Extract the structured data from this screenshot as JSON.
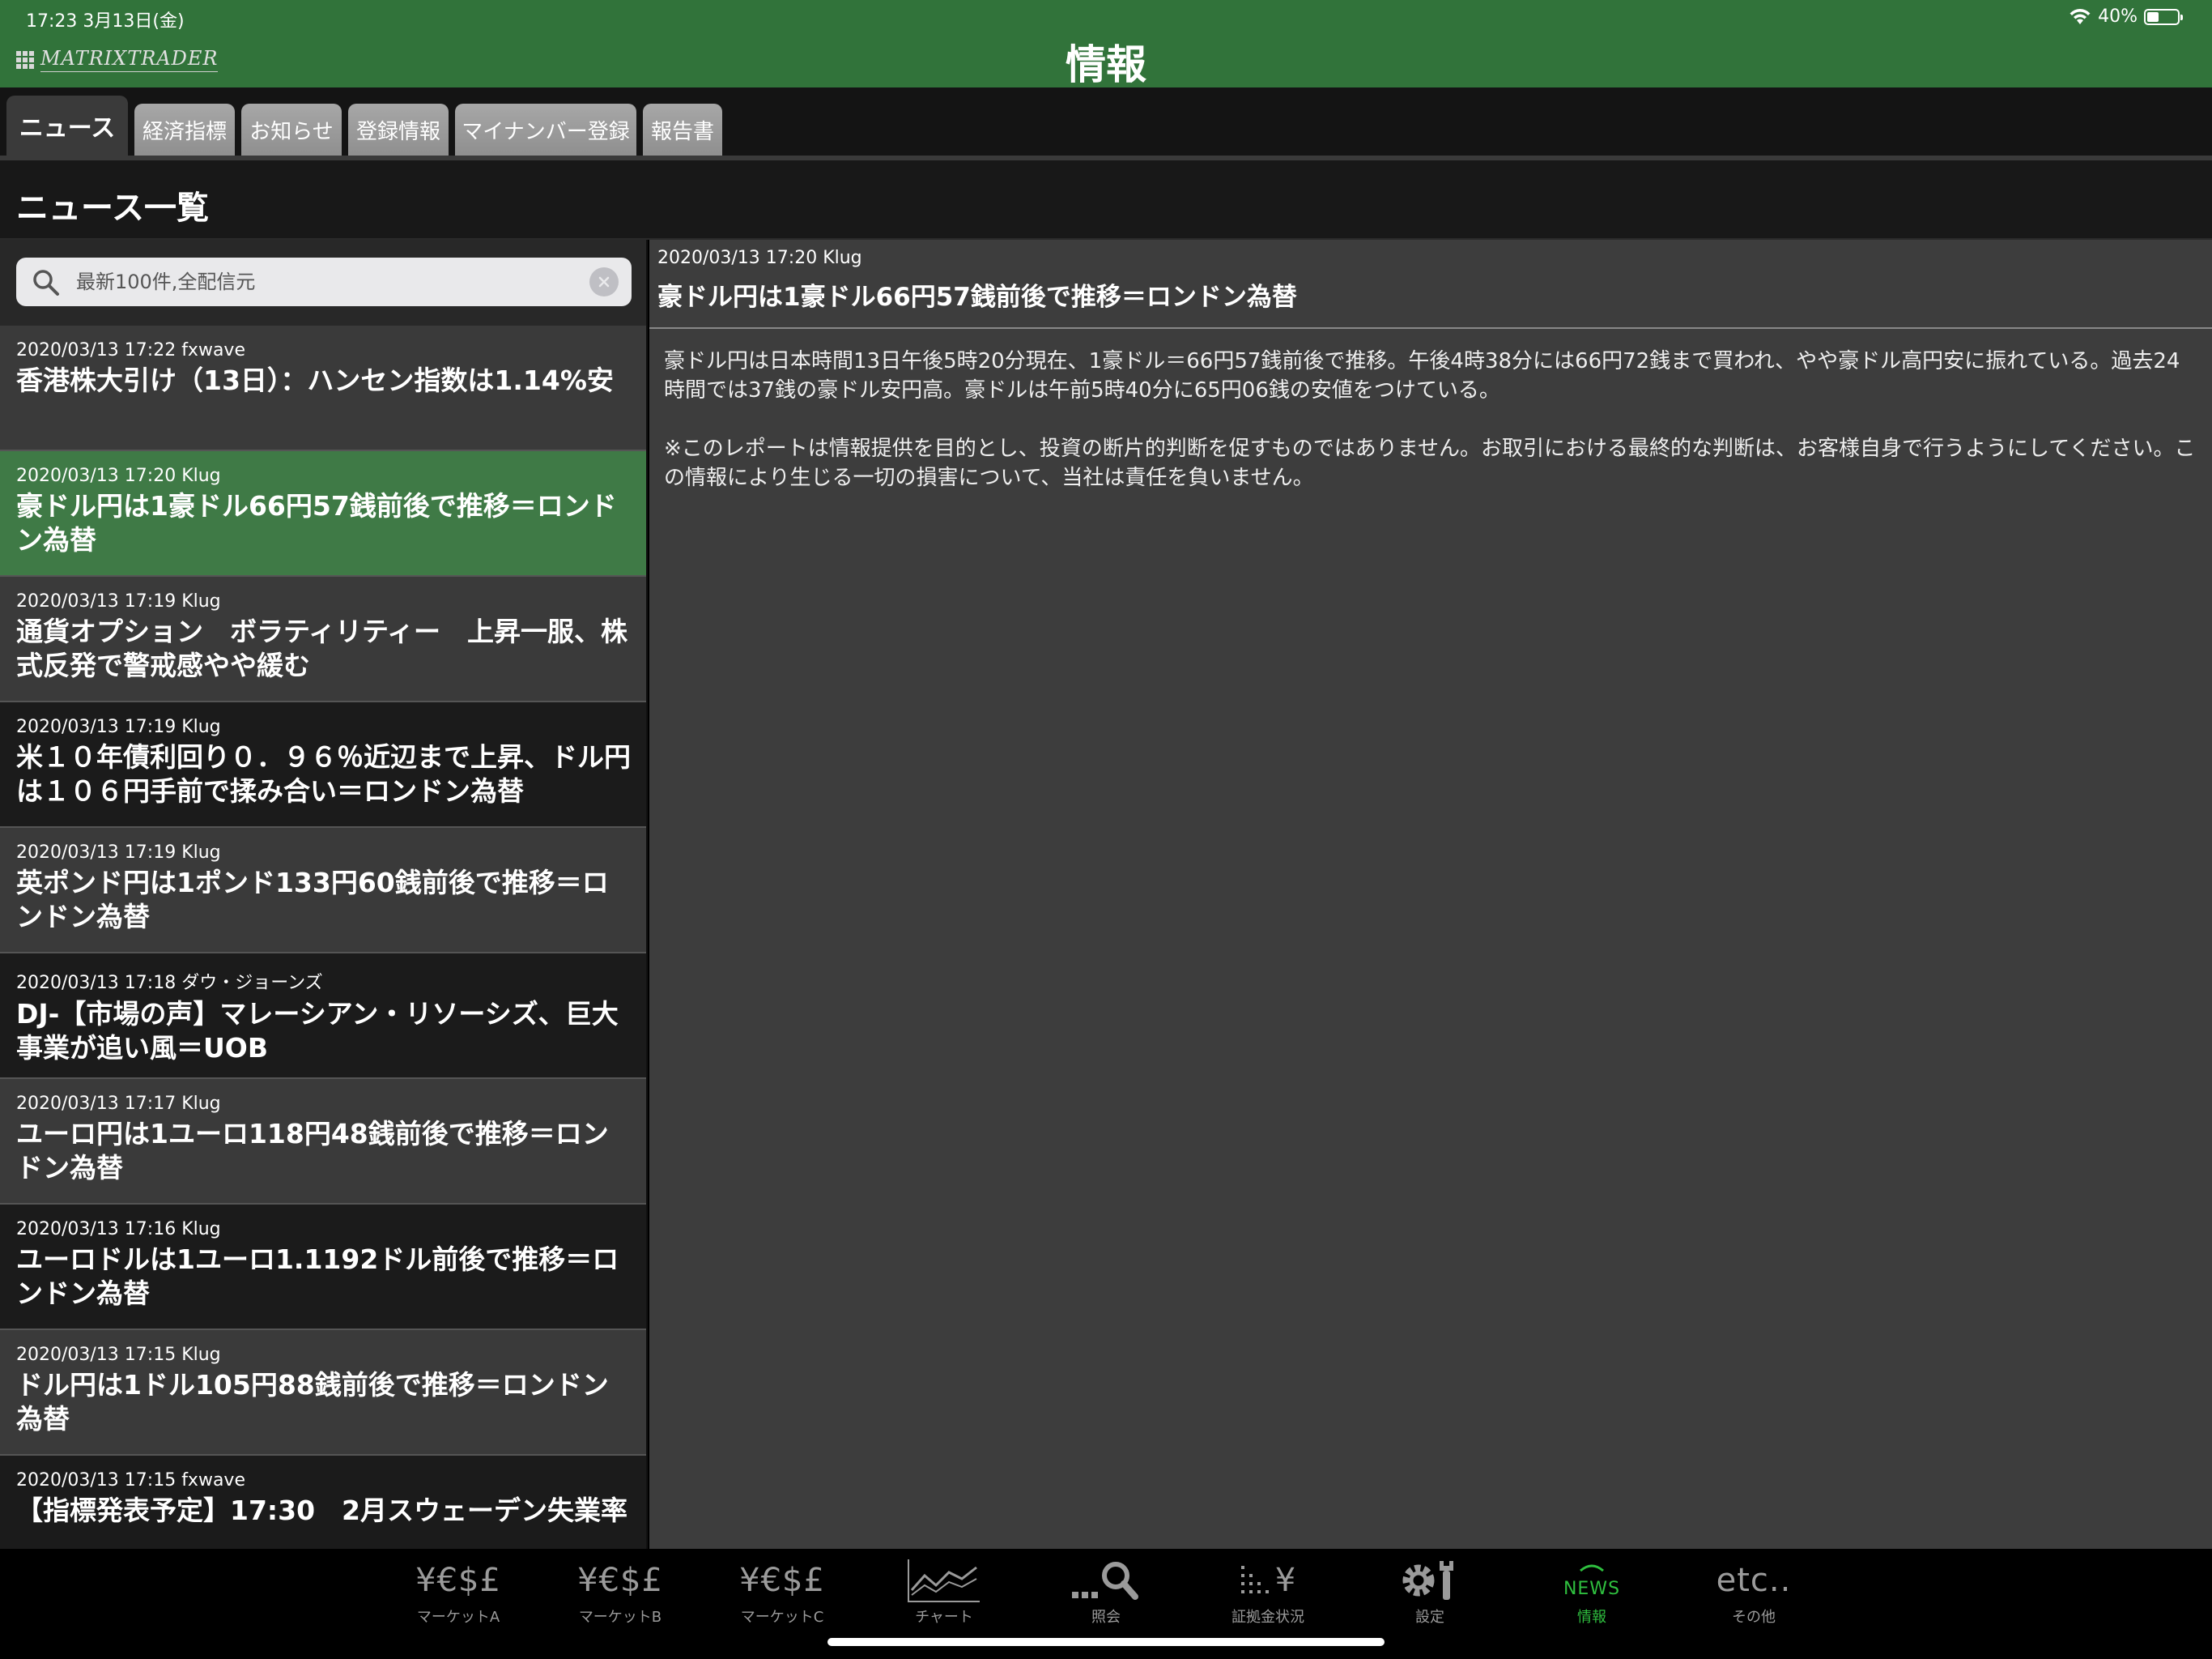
{
  "status_bar": {
    "time_date": "17:23   3月13日(金)",
    "battery": "40%",
    "battery_fraction": 0.4
  },
  "header": {
    "logo_text": "MATRIXTRADER",
    "title": "情報"
  },
  "tabs": [
    {
      "label": "ニュース",
      "active": true
    },
    {
      "label": "経済指標",
      "active": false
    },
    {
      "label": "お知らせ",
      "active": false
    },
    {
      "label": "登録情報",
      "active": false
    },
    {
      "label": "マイナンバー登録",
      "active": false
    },
    {
      "label": "報告書",
      "active": false
    }
  ],
  "section": {
    "title": "ニュース一覧"
  },
  "search": {
    "value": "",
    "placeholder": "最新100件,全配信元"
  },
  "news_list": [
    {
      "meta": "2020/03/13 17:22 fxwave",
      "headline": "香港株大引け（13日）：ハンセン指数は1.14%安"
    },
    {
      "meta": "2020/03/13 17:20 Klug",
      "headline": "豪ドル円は1豪ドル66円57銭前後で推移＝ロンドン為替",
      "selected": true
    },
    {
      "meta": "2020/03/13 17:19 Klug",
      "headline": "通貨オプション　ボラティリティー　上昇一服、株式反発で警戒感やや緩む"
    },
    {
      "meta": "2020/03/13 17:19 Klug",
      "headline": "米１０年債利回り０．９６％近辺まで上昇、ドル円は１０６円手前で揉み合い＝ロンドン為替"
    },
    {
      "meta": "2020/03/13 17:19 Klug",
      "headline": "英ポンド円は1ポンド133円60銭前後で推移＝ロンドン為替"
    },
    {
      "meta": "2020/03/13 17:18 ダウ・ジョーンズ",
      "headline": "DJ-【市場の声】マレーシアン・リソーシズ、巨大事業が追い風＝UOB"
    },
    {
      "meta": "2020/03/13 17:17 Klug",
      "headline": "ユーロ円は1ユーロ118円48銭前後で推移＝ロンドン為替"
    },
    {
      "meta": "2020/03/13 17:16 Klug",
      "headline": "ユーロドルは1ユーロ1.1192ドル前後で推移＝ロンドン為替"
    },
    {
      "meta": "2020/03/13 17:15 Klug",
      "headline": "ドル円は1ドル105円88銭前後で推移＝ロンドン為替"
    },
    {
      "meta": "2020/03/13 17:15 fxwave",
      "headline": "【指標発表予定】17:30　2月スウェーデン失業率"
    }
  ],
  "detail": {
    "meta": "2020/03/13 17:20 Klug",
    "title": "豪ドル円は1豪ドル66円57銭前後で推移＝ロンドン為替",
    "body": [
      "豪ドル円は日本時間13日午後5時20分現在、1豪ドル＝66円57銭前後で推移。午後4時38分には66円72銭まで買われ、やや豪ドル高円安に振れている。過去24時間では37銭の豪ドル安円高。豪ドルは午前5時40分に65円06銭の安値をつけている。",
      "※このレポートは情報提供を目的とし、投資の断片的判断を促すものではありません。お取引における最終的な判断は、お客様自身で行うようにしてください。この情報により生じる一切の損害について、当社は責任を負いません。"
    ]
  },
  "bottom_tabs": [
    {
      "icon_text": "¥€$£",
      "label": "マーケットA",
      "icon_name": "currency-icon"
    },
    {
      "icon_text": "¥€$£",
      "label": "マーケットB",
      "icon_name": "currency-icon"
    },
    {
      "icon_text": "¥€$£",
      "label": "マーケットC",
      "icon_name": "currency-icon"
    },
    {
      "icon_text": "",
      "label": "チャート",
      "icon_name": "chart-icon"
    },
    {
      "icon_text": "",
      "label": "照会",
      "icon_name": "search-icon"
    },
    {
      "icon_text": "¥",
      "label": "証拠金状況",
      "icon_name": "margin-icon"
    },
    {
      "icon_text": "",
      "label": "設定",
      "icon_name": "gear-wrench-icon"
    },
    {
      "icon_text": "NEWS",
      "label": "情報",
      "icon_name": "news-icon",
      "active": true
    },
    {
      "icon_text": "etc..",
      "label": "その他",
      "icon_name": "etc-icon"
    }
  ],
  "colors": {
    "header_green": "#31733a",
    "selected_green": "#3f7a46",
    "active_tab_green": "#2fbf3f"
  }
}
